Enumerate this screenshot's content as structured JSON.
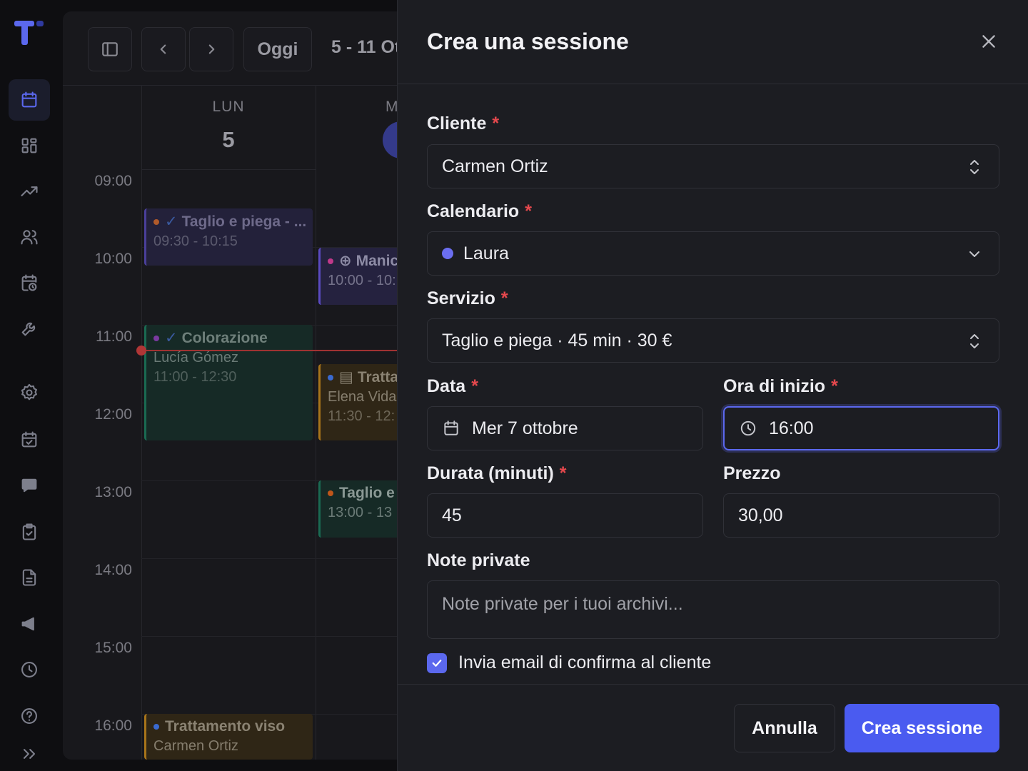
{
  "calendar": {
    "toolbar": {
      "today_label": "Oggi",
      "week_range": "5 - 11 Ot"
    },
    "days": [
      {
        "name": "LUN",
        "number": "5"
      },
      {
        "name": "M",
        "number": ""
      }
    ],
    "times": [
      "09:00",
      "10:00",
      "11:00",
      "12:00",
      "13:00",
      "14:00",
      "15:00",
      "16:00"
    ],
    "events": [
      {
        "title": "Taglio e piega - ...",
        "line2": "09:30 - 10:15",
        "color": "#6a5acd"
      },
      {
        "title": "Manic",
        "line2": "10:00 - 10:",
        "color": "#6a5acd"
      },
      {
        "title": "Colorazione",
        "line2": "Lucía Gómez",
        "line3": "11:00 - 12:30",
        "color": "#1f8a6a"
      },
      {
        "title": "Tratta",
        "line2": "Elena Vida",
        "line3": "11:30 - 12:",
        "color": "#c98a1a"
      },
      {
        "title": "Taglio e",
        "line2": "13:00 - 13",
        "color": "#1f8a6a"
      },
      {
        "title": "Trattamento viso",
        "line2": "Carmen Ortiz",
        "color": "#c98a1a"
      }
    ]
  },
  "dialog": {
    "title": "Crea una sessione",
    "fields": {
      "client": {
        "label": "Cliente",
        "value": "Carmen Ortiz"
      },
      "calendar": {
        "label": "Calendario",
        "value": "Laura",
        "dot_color": "#6b6ef0"
      },
      "service": {
        "label": "Servizio",
        "value": "Taglio e piega · 45 min · 30 €"
      },
      "date": {
        "label": "Data",
        "value": "Mer 7 ottobre"
      },
      "start_time": {
        "label": "Ora di inizio",
        "value": "16:00"
      },
      "duration": {
        "label": "Durata (minuti)",
        "value": "45"
      },
      "price": {
        "label": "Prezzo",
        "value": "30,00"
      },
      "notes": {
        "label": "Note private",
        "placeholder": "Note private per i tuoi archivi..."
      }
    },
    "required_mark": "*",
    "send_email": {
      "label": "Invia email di confirma al cliente",
      "checked": true
    },
    "buttons": {
      "cancel": "Annulla",
      "create": "Crea sessione"
    }
  },
  "colors": {
    "accent": "#4a5bf0",
    "required": "#e5484d"
  }
}
